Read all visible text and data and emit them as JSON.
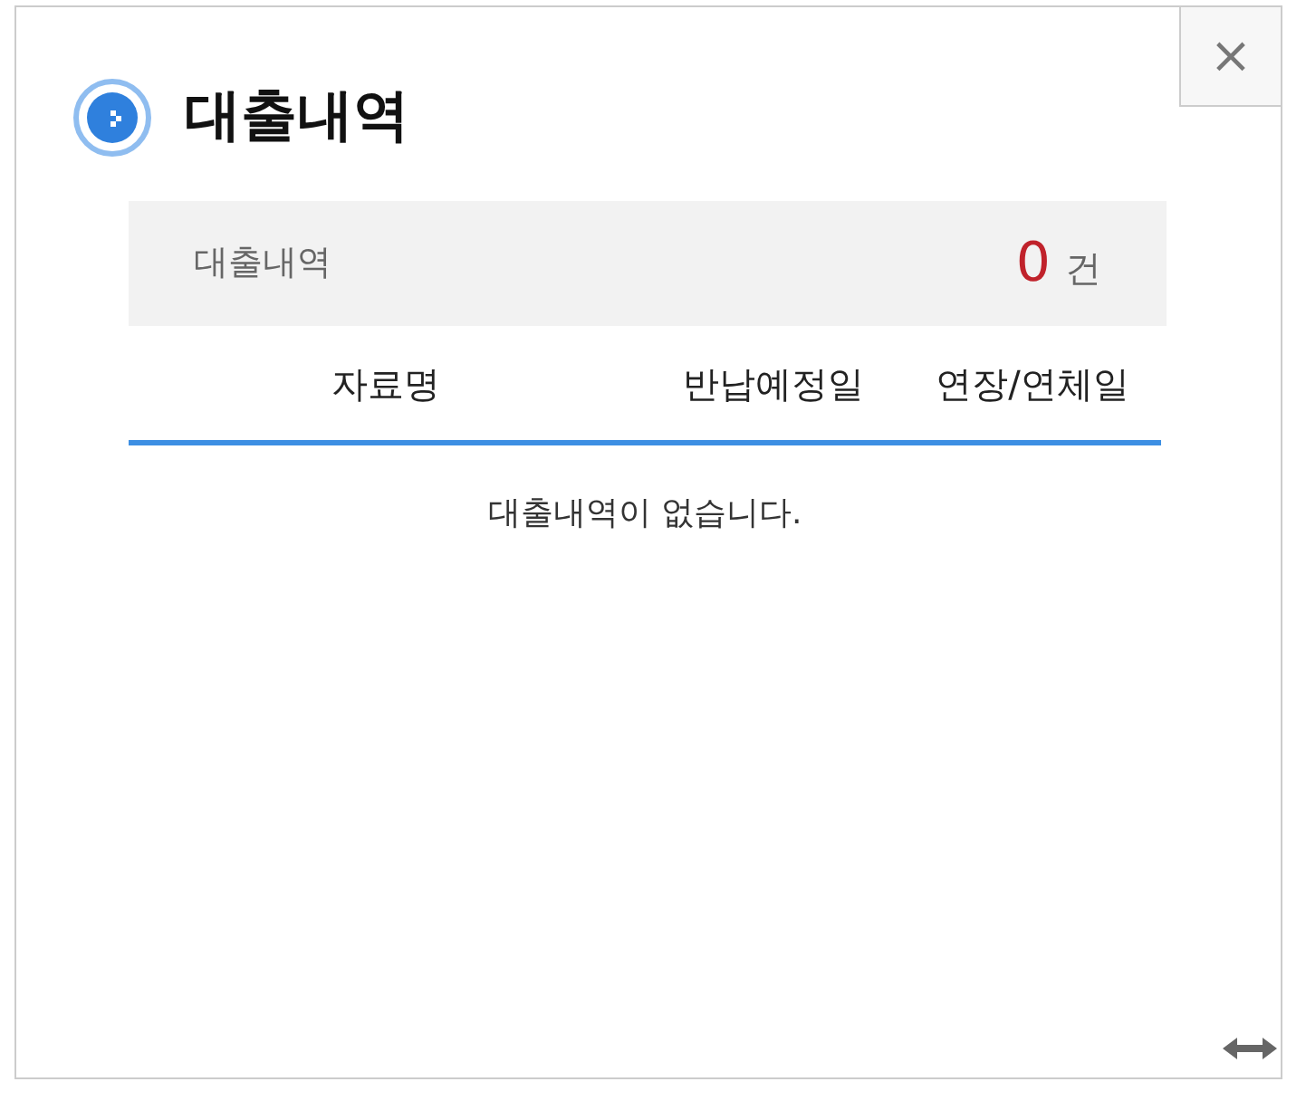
{
  "dialog": {
    "title": "대출내역",
    "close": "×"
  },
  "summary": {
    "label": "대출내역",
    "count": "0",
    "unit": "건"
  },
  "table": {
    "columns": [
      "자료명",
      "반납예정일",
      "연장/연체일"
    ],
    "empty_message": "대출내역이 없습니다."
  }
}
